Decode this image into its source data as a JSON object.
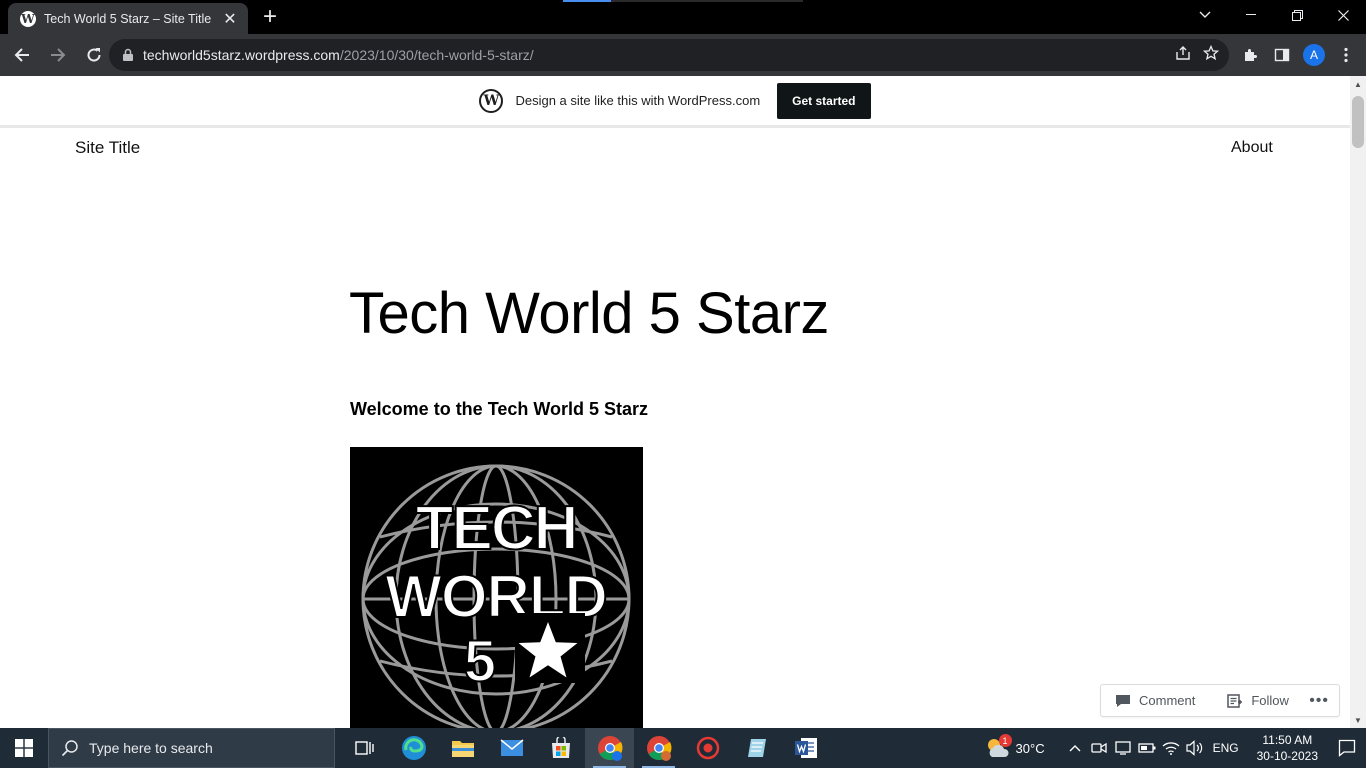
{
  "browser": {
    "tab": {
      "title": "Tech World 5 Starz – Site Title",
      "favicon": "wordpress-icon"
    },
    "url_host": "techworld5starz.wordpress.com",
    "url_path": "/2023/10/30/tech-world-5-starz/",
    "profile_initial": "A"
  },
  "wp_banner": {
    "promo_text": "Design a site like this with WordPress.com",
    "cta_label": "Get started"
  },
  "site": {
    "title": "Site Title",
    "nav_items": [
      "About"
    ]
  },
  "post": {
    "title": "Tech World 5 Starz",
    "intro": "Welcome to the Tech World 5 Starz",
    "image": {
      "line1": "TECH",
      "line2": "WORLD",
      "line3": "5"
    }
  },
  "action_bar": {
    "comment_label": "Comment",
    "follow_label": "Follow"
  },
  "taskbar": {
    "search_placeholder": "Type here to search",
    "weather": "30°C",
    "weather_badge": "1",
    "language": "ENG",
    "time": "11:50 AM",
    "date": "30-10-2023"
  },
  "colors": {
    "chrome_dark": "#35363a",
    "accent_blue": "#1a73e8",
    "taskbar_bg": "#1f2b36"
  }
}
